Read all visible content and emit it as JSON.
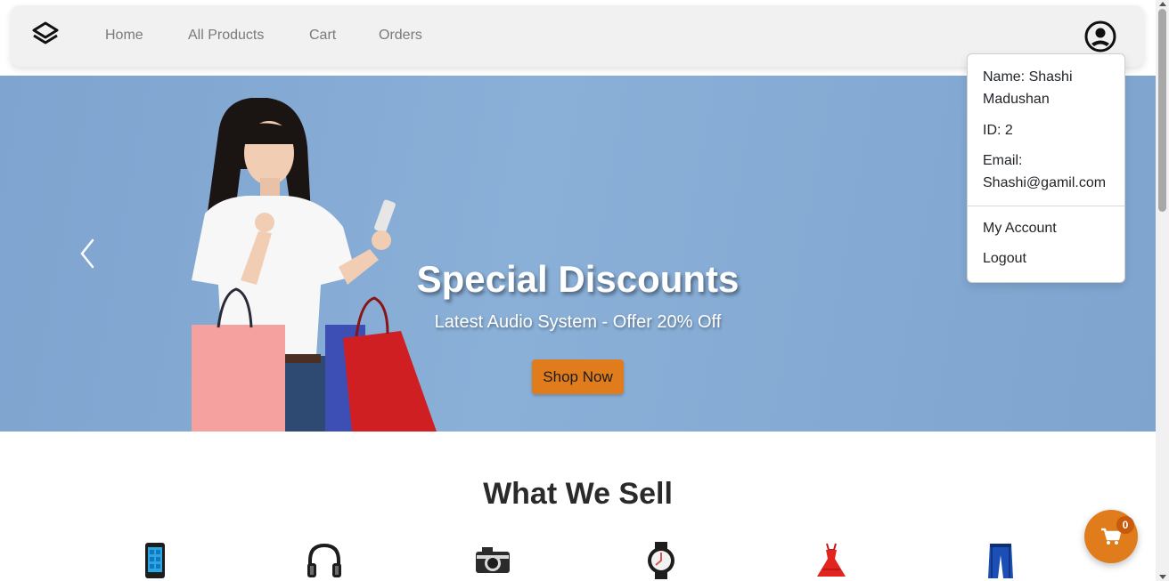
{
  "nav": {
    "links": [
      "Home",
      "All Products",
      "Cart",
      "Orders"
    ]
  },
  "profile_menu": {
    "name_line1": "Name: Shashi",
    "name_line2": "Madushan",
    "id": "ID: 2",
    "email_label": "Email:",
    "email_value": "Shashi@gamil.com",
    "items": [
      "My Account",
      "Logout"
    ]
  },
  "hero": {
    "title": "Special Discounts",
    "subtitle": "Latest Audio System - Offer 20% Off",
    "button": "Shop Now"
  },
  "section": {
    "title": "What We Sell",
    "categories": [
      "phone-icon",
      "headphones-icon",
      "camera-icon",
      "watch-icon",
      "dress-icon",
      "jeans-icon"
    ]
  },
  "cart": {
    "count": "0"
  },
  "colors": {
    "accent": "#e17c1d",
    "hero_bg": "#8ab0d8",
    "navbar_bg": "#f1f1f1"
  }
}
